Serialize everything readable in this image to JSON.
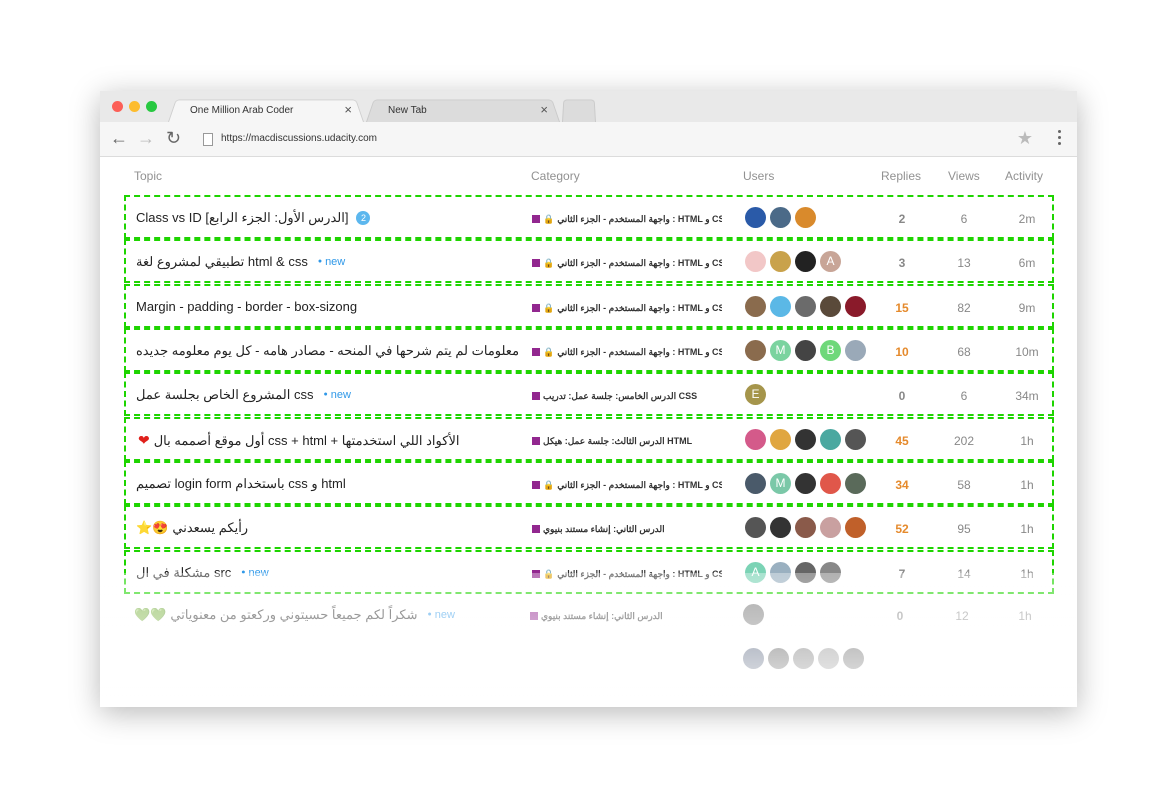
{
  "browser": {
    "tabs": [
      {
        "label": "One Million Arab Coder",
        "close": "×"
      },
      {
        "label": "New Tab",
        "close": "×"
      }
    ],
    "url": "https://macdiscussions.udacity.com",
    "nav": {
      "back": "←",
      "forward": "→",
      "reload": "↻",
      "star": "★"
    }
  },
  "table": {
    "headers": {
      "topic": "Topic",
      "category": "Category",
      "users": "Users",
      "replies": "Replies",
      "views": "Views",
      "activity": "Activity"
    },
    "rows": [
      {
        "title": "Class vs ID [الدرس الأول: الجزء الرابع]",
        "badge": "2",
        "new": "",
        "category": "واجهة المستخدم - الجزء الثاني : HTML و CSS",
        "locked": true,
        "replies": "2",
        "views": "6",
        "activity": "2m",
        "avatars": [
          "#2a5aa8",
          "#4b6a88",
          "#d98a2c"
        ]
      },
      {
        "title": "تطبيقي لمشروع لغة html & css",
        "badge": "",
        "new": "new",
        "category": "واجهة المستخدم - الجزء الثاني : HTML و CSS",
        "locked": true,
        "replies": "3",
        "views": "13",
        "activity": "6m",
        "avatars": [
          "#f2c7c7",
          "#c9a24b",
          "#222222",
          "#c8a597"
        ],
        "letters": [
          "",
          "",
          "",
          "A"
        ]
      },
      {
        "title": "Margin - padding - border - box-sizong",
        "badge": "",
        "new": "",
        "category": "واجهة المستخدم - الجزء الثاني : HTML و CSS",
        "locked": true,
        "replies": "15",
        "views": "82",
        "activity": "9m",
        "avatars": [
          "#8a6b4d",
          "#5bb8e6",
          "#6b6b6b",
          "#5a4a3a",
          "#8a1a2a"
        ]
      },
      {
        "title": "معلومات لم يتم شرحها في المنحه - مصادر هامه - كل يوم معلومه جديده",
        "badge": "",
        "new": "",
        "category": "واجهة المستخدم - الجزء الثاني : HTML و CSS",
        "locked": true,
        "replies": "10",
        "views": "68",
        "activity": "10m",
        "avatars": [
          "#8a6b4d",
          "#7bd39f",
          "#444444",
          "#6fd87a",
          "#9aa9b8"
        ],
        "letters": [
          "",
          "M",
          "",
          "B",
          ""
        ]
      },
      {
        "title": "المشروع الخاص بجلسة عمل css",
        "badge": "",
        "new": "new",
        "category": "الدرس الخامس: جلسة عمل: تدريب CSS",
        "locked": false,
        "replies": "0",
        "views": "6",
        "activity": "34m",
        "avatars": [
          "#a5954b"
        ],
        "letters": [
          "E"
        ]
      },
      {
        "title": "أول موقع أصممه بال css + html + الأكواد اللي استخدمتها",
        "badge": "",
        "new": "",
        "heart": "❤",
        "category": "الدرس الثالث: جلسة عمل: هيكل HTML",
        "locked": false,
        "replies": "45",
        "views": "202",
        "activity": "1h",
        "avatars": [
          "#d45a8a",
          "#e0a640",
          "#333333",
          "#4aa8a0",
          "#555555"
        ]
      },
      {
        "title": "تصميم login form باستخدام css و html",
        "badge": "",
        "new": "",
        "category": "واجهة المستخدم - الجزء الثاني : HTML و CSS",
        "locked": true,
        "replies": "34",
        "views": "58",
        "activity": "1h",
        "avatars": [
          "#4a5a6a",
          "#7bc8a8",
          "#333333",
          "#e0574a",
          "#5a6a5a"
        ],
        "letters": [
          "",
          "M",
          "",
          "",
          ""
        ]
      },
      {
        "title": "رأيكم يسعدني",
        "badge": "",
        "new": "",
        "emoji": "⭐😍",
        "category": "الدرس الثاني: إنشاء مستند بنيوي",
        "locked": false,
        "replies": "52",
        "views": "95",
        "activity": "1h",
        "avatars": [
          "#555555",
          "#333333",
          "#8a5a4a",
          "#c9a0a0",
          "#c0602a"
        ]
      },
      {
        "title": "مشكلة في ال src",
        "badge": "",
        "new": "new",
        "category": "واجهة المستخدم - الجزء الثاني : HTML و CSS",
        "locked": true,
        "replies": "7",
        "views": "14",
        "activity": "1h",
        "avatars": [
          "#7bd3b5",
          "#9ab0c0",
          "#666666",
          "#888888"
        ],
        "letters": [
          "A",
          "",
          "",
          ""
        ]
      },
      {
        "title": "شكراً لكم جميعاً حسيتوني وركعتو من معنوياتي",
        "badge": "",
        "new": "new",
        "emoji": "💚💚",
        "category": "الدرس الثاني: إنشاء مستند بنيوي",
        "locked": false,
        "replies": "0",
        "views": "12",
        "activity": "1h",
        "avatars": [
          "#777777"
        ]
      },
      {
        "title": "",
        "badge": "",
        "new": "",
        "category": "",
        "locked": false,
        "replies": "",
        "views": "",
        "activity": "",
        "avatars": [
          "#2a3a5a",
          "#333333",
          "#555555",
          "#777777",
          "#444444"
        ]
      }
    ]
  },
  "colors": {
    "category_swatch": "#92278f",
    "highlight_border": "#1ed400",
    "hot_replies": "#e58a2c",
    "new_tag": "#2f98e8"
  }
}
